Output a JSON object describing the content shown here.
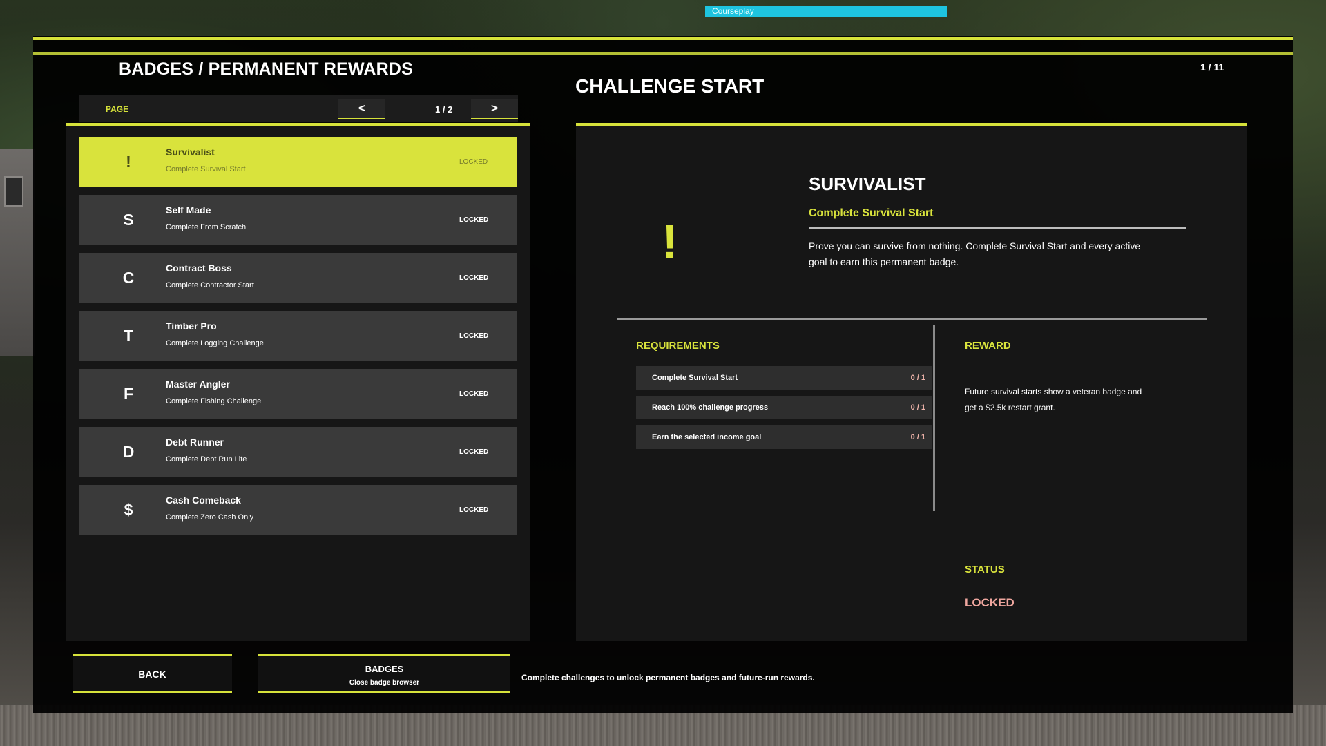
{
  "hud": {
    "courseplay_label": "Courseplay"
  },
  "header": {
    "screen_title": "BADGES / PERMANENT REWARDS",
    "right_title": "CHALLENGE START",
    "page_counter": "1 / 11"
  },
  "pager": {
    "label": "PAGE",
    "prev": "<",
    "next": ">",
    "current": "1 / 2"
  },
  "badges": [
    {
      "letter": "!",
      "name": "Survivalist",
      "subtitle": "Complete Survival Start",
      "state": "LOCKED",
      "selected": true
    },
    {
      "letter": "S",
      "name": "Self Made",
      "subtitle": "Complete From Scratch",
      "state": "LOCKED"
    },
    {
      "letter": "C",
      "name": "Contract Boss",
      "subtitle": "Complete Contractor Start",
      "state": "LOCKED"
    },
    {
      "letter": "T",
      "name": "Timber Pro",
      "subtitle": "Complete Logging Challenge",
      "state": "LOCKED"
    },
    {
      "letter": "F",
      "name": "Master Angler",
      "subtitle": "Complete Fishing Challenge",
      "state": "LOCKED"
    },
    {
      "letter": "D",
      "name": "Debt Runner",
      "subtitle": "Complete Debt Run Lite",
      "state": "LOCKED"
    },
    {
      "letter": "$",
      "name": "Cash Comeback",
      "subtitle": "Complete Zero Cash Only",
      "state": "LOCKED"
    }
  ],
  "detail": {
    "icon": "!",
    "title": "SURVIVALIST",
    "subtitle": "Complete Survival Start",
    "description": "Prove you can survive from nothing. Complete Survival Start and every active goal to earn this permanent badge.",
    "requirements_heading": "REQUIREMENTS",
    "requirements": [
      {
        "text": "Complete Survival Start",
        "value": "0 / 1"
      },
      {
        "text": "Reach 100% challenge progress",
        "value": "0 / 1"
      },
      {
        "text": "Earn the selected income goal",
        "value": "0 / 1"
      }
    ],
    "reward_heading": "REWARD",
    "reward_text": "Future survival starts show a veteran badge and get a $2.5k restart grant.",
    "status_heading": "STATUS",
    "status_value": "LOCKED"
  },
  "footer": {
    "back_label": "BACK",
    "badges_label": "BADGES",
    "badges_sub": "Close badge browser",
    "hint": "Complete challenges to unlock permanent badges and future-run rewards."
  },
  "colors": {
    "accent": "#d9e33c",
    "locked": "#f0a79f",
    "panel": "#161616",
    "row": "#3a3a3a"
  }
}
